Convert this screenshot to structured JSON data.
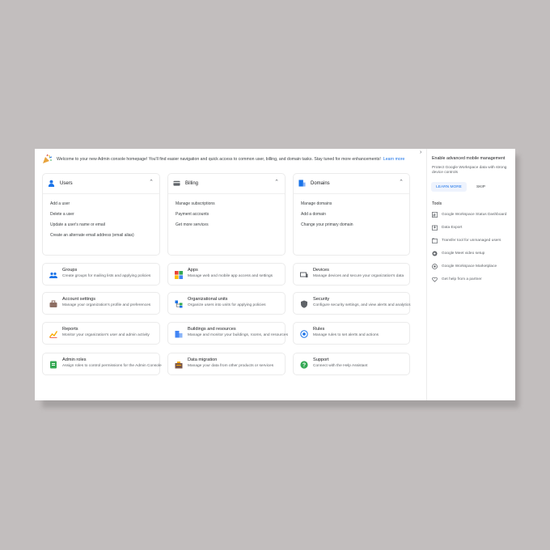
{
  "banner": {
    "text": "Welcome to your new Admin console homepage! You'll find easier navigation and quick access to common user, billing, and domain tasks. Stay tuned for more enhancements!",
    "link": "Learn more"
  },
  "big_cards": [
    {
      "title": "Users",
      "icon": "person-icon",
      "links": [
        "Add a user",
        "Delete a user",
        "Update a user's name or email",
        "Create an alternate email address (email alias)"
      ]
    },
    {
      "title": "Billing",
      "icon": "credit-card-icon",
      "links": [
        "Manage subscriptions",
        "Payment accounts",
        "Get more services"
      ]
    },
    {
      "title": "Domains",
      "icon": "domain-icon",
      "links": [
        "Manage domains",
        "Add a domain",
        "Change your primary domain"
      ]
    }
  ],
  "tiles": [
    {
      "title": "Groups",
      "desc": "Create groups for mailing lists and applying policies",
      "icon": "groups-icon"
    },
    {
      "title": "Apps",
      "desc": "Manage web and mobile app access and settings",
      "icon": "apps-icon"
    },
    {
      "title": "Devices",
      "desc": "Manage devices and secure your organization's data",
      "icon": "devices-icon"
    },
    {
      "title": "Account settings",
      "desc": "Manage your organization's profile and preferences",
      "icon": "briefcase-icon"
    },
    {
      "title": "Organizational units",
      "desc": "Organize users into units for applying policies",
      "icon": "org-units-icon"
    },
    {
      "title": "Security",
      "desc": "Configure security settings, and view alerts and analytics",
      "icon": "shield-icon"
    },
    {
      "title": "Reports",
      "desc": "Monitor your organization's user and admin activity",
      "icon": "reports-icon"
    },
    {
      "title": "Buildings and resources",
      "desc": "Manage and monitor your buildings, rooms, and resources",
      "icon": "buildings-icon"
    },
    {
      "title": "Rules",
      "desc": "Manage rules to set alerts and actions",
      "icon": "rules-icon"
    },
    {
      "title": "Admin roles",
      "desc": "Assign roles to control permissions for the Admin Console",
      "icon": "admin-roles-icon"
    },
    {
      "title": "Data migration",
      "desc": "Manage your data from other products or services",
      "icon": "data-migration-icon"
    },
    {
      "title": "Support",
      "desc": "Connect with the Help Assistant",
      "icon": "help-icon"
    }
  ],
  "right_panel": {
    "title": "Enable advanced mobile management",
    "desc": "Protect Google Workspace data with strong device controls",
    "learn_more": "LEARN MORE",
    "skip": "SKIP",
    "tools_label": "Tools",
    "tools": [
      {
        "label": "Google Workspace Status Dashboard",
        "icon": "dashboard-icon"
      },
      {
        "label": "Data Export",
        "icon": "export-icon"
      },
      {
        "label": "Transfer tool for unmanaged users",
        "icon": "transfer-icon"
      },
      {
        "label": "Google Meet video setup",
        "icon": "meet-icon"
      },
      {
        "label": "Google Workspace Marketplace",
        "icon": "marketplace-icon"
      },
      {
        "label": "Get help from a partner",
        "icon": "partner-icon"
      }
    ]
  },
  "colors": {
    "accent": "#1a73e8",
    "text": "#202124",
    "muted": "#5f6368",
    "background": "#c2bebe"
  }
}
